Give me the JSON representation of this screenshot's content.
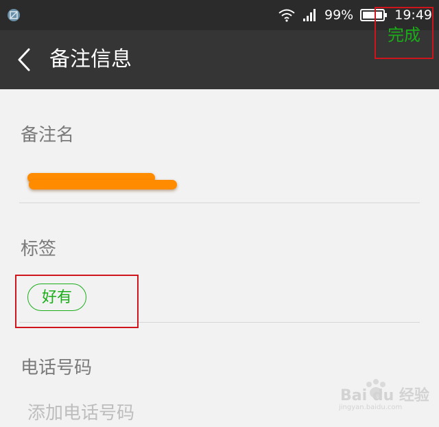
{
  "status_bar": {
    "battery": "99%",
    "time": "19:49",
    "icons": [
      "app-notification-icon",
      "wifi-icon",
      "signal-icon",
      "battery-icon"
    ]
  },
  "app_bar": {
    "title": "备注信息",
    "done_label": "完成",
    "back_icon": "chevron-left-icon"
  },
  "remark": {
    "label": "备注名",
    "value_redacted": true
  },
  "tags": {
    "label": "标签",
    "items": [
      "好有"
    ]
  },
  "phone": {
    "label": "电话号码",
    "placeholder": "添加电话号码"
  },
  "watermark": {
    "brand": "Bai du 经验",
    "url": "jingyan.baidu.com"
  },
  "colors": {
    "accent_green": "#1aad19",
    "highlight_red": "#d0141b",
    "status_bar_bg": "#2b2b2b",
    "app_bar_bg": "#353535",
    "page_bg": "#f2f2f2",
    "redaction_orange": "#ff8c00"
  }
}
